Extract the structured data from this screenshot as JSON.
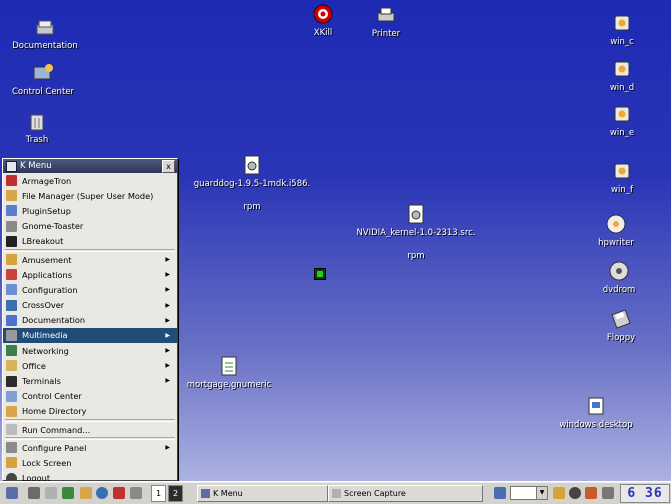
{
  "desktop": {
    "icons": [
      {
        "name": "Documentation",
        "icon": "documentation-icon"
      },
      {
        "name": "Control Center",
        "icon": "control-center-icon"
      },
      {
        "name": "Trash",
        "icon": "trash-icon"
      },
      {
        "name": "XKill",
        "icon": "xkill-icon"
      },
      {
        "name": "Printer",
        "icon": "printer-icon"
      },
      {
        "name": "win_c",
        "icon": "drive-icon"
      },
      {
        "name": "win_d",
        "icon": "drive-icon"
      },
      {
        "name": "win_e",
        "icon": "drive-icon"
      },
      {
        "name": "win_f",
        "icon": "drive-icon"
      },
      {
        "name": "hpwriter",
        "icon": "cd-writer-icon"
      },
      {
        "name": "dvdrom",
        "icon": "dvd-icon"
      },
      {
        "name": "Floppy",
        "icon": "floppy-icon"
      },
      {
        "name": "guarddog-1.9.5-1mdk.i586.",
        "sub": "rpm",
        "icon": "rpm-package-icon"
      },
      {
        "name": "NVIDIA_kernel-1.0-2313.src.",
        "sub": "rpm",
        "icon": "rpm-package-icon"
      },
      {
        "name": "mortgage.gnumeric",
        "icon": "spreadsheet-icon"
      },
      {
        "name": "windows desktop",
        "icon": "windows-desktop-icon"
      }
    ]
  },
  "kmenu": {
    "title": "K Menu",
    "close": "x",
    "recent": [
      "ArmageTron",
      "File Manager (Super User Mode)",
      "PluginSetup",
      "Gnome-Toaster",
      "LBreakout"
    ],
    "categories": [
      "Amusement",
      "Applications",
      "Configuration",
      "CrossOver",
      "Documentation",
      "Multimedia",
      "Networking",
      "Office",
      "Terminals"
    ],
    "active": "Multimedia",
    "links": [
      "Control Center",
      "Home Directory"
    ],
    "run": "Run Command...",
    "bottom": [
      "Configure Panel",
      "Lock Screen",
      "Logout"
    ]
  },
  "taskbar": {
    "pager": [
      "1",
      "2"
    ],
    "tasks": [
      "K Menu",
      "Screen Capture"
    ],
    "clock": "6 36"
  },
  "colors": {
    "active_item": "#1f4d77",
    "desktop_top": "#1d2ab4",
    "desktop_bottom": "#b7bde6"
  }
}
